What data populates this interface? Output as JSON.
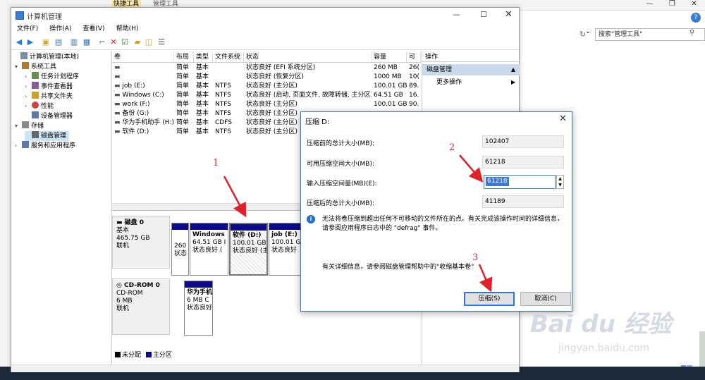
{
  "background": {
    "ribbon_tab_active": "快捷工具",
    "ribbon_tab_other": "管理工具",
    "search_placeholder": "搜索\"管理工具\""
  },
  "window": {
    "title": "计算机管理",
    "menu": [
      "文件(F)",
      "操作(A)",
      "查看(V)",
      "帮助(H)"
    ]
  },
  "tree": [
    {
      "label": "计算机管理(本地)",
      "indent": 0,
      "arrow": ""
    },
    {
      "label": "系统工具",
      "indent": 1,
      "arrow": "▾"
    },
    {
      "label": "任务计划程序",
      "indent": 2,
      "arrow": "›"
    },
    {
      "label": "事件查看器",
      "indent": 2,
      "arrow": "›"
    },
    {
      "label": "共享文件夹",
      "indent": 2,
      "arrow": "›"
    },
    {
      "label": "性能",
      "indent": 2,
      "arrow": "›"
    },
    {
      "label": "设备管理器",
      "indent": 2,
      "arrow": ""
    },
    {
      "label": "存储",
      "indent": 1,
      "arrow": "▾"
    },
    {
      "label": "磁盘管理",
      "indent": 2,
      "arrow": ""
    },
    {
      "label": "服务和应用程序",
      "indent": 1,
      "arrow": "›"
    }
  ],
  "volumes": {
    "columns": [
      "卷",
      "布局",
      "类型",
      "文件系统",
      "状态",
      "容量",
      "可"
    ],
    "rows": [
      [
        "",
        "简单",
        "基本",
        "",
        "状态良好 (EFI 系统分区)",
        "260 MB",
        "26("
      ],
      [
        "",
        "简单",
        "基本",
        "",
        "状态良好 (恢复分区)",
        "1000 MB",
        "10("
      ],
      [
        "job (E:)",
        "简单",
        "基本",
        "NTFS",
        "状态良好 (主分区)",
        "100.01 GB",
        "89."
      ],
      [
        "Windows (C:)",
        "简单",
        "基本",
        "NTFS",
        "状态良好 (启动, 页面文件, 故障转储, 主分区)",
        "64.51 GB",
        "16."
      ],
      [
        "work (F:)",
        "简单",
        "基本",
        "NTFS",
        "状态良好 (主分区)",
        "100.01 GB",
        "90."
      ],
      [
        "备份 (G:)",
        "简单",
        "基本",
        "NTFS",
        "状态良好 (主分区)",
        "",
        ""
      ],
      [
        "华为手机助手 (H:)",
        "简单",
        "基本",
        "CDFS",
        "状态良好 (主分区)",
        "",
        ""
      ],
      [
        "软件 (D:)",
        "简单",
        "基本",
        "NTFS",
        "状态良好 (主分区)",
        "",
        ""
      ]
    ]
  },
  "disks": {
    "disk0": {
      "name": "磁盘 0",
      "type": "基本",
      "size": "465.75 GB",
      "status": "联机"
    },
    "disk0_parts": [
      {
        "name": "",
        "size": "260",
        "status": "状态"
      },
      {
        "name": "Windows",
        "size": "64.51 GB I",
        "status": "状态良好 ("
      },
      {
        "name": "软件 (D:)",
        "size": "100.01 GB",
        "status": "状态良好 (主"
      },
      {
        "name": "job (E:)",
        "size": "100.01 G",
        "status": "状态良好"
      }
    ],
    "cdrom": {
      "name": "CD-ROM 0",
      "type": "CD-ROM",
      "size": "6 MB",
      "status": "联机"
    },
    "cdrom_part": {
      "name": "华为手机",
      "size": "6 MB C",
      "status": "状态良好"
    },
    "legend": [
      "未分配",
      "主分区"
    ]
  },
  "actions": {
    "header": "操作",
    "section": "磁盘管理",
    "more": "更多操作"
  },
  "dialog": {
    "title": "压缩 D:",
    "total_before_label": "压缩前的总计大小(MB):",
    "total_before_value": "102407",
    "available_label": "可用压缩空间大小(MB):",
    "available_value": "61218",
    "input_label": "输入压缩空间量(MB)(E):",
    "input_value": "61218",
    "total_after_label": "压缩后的总计大小(MB):",
    "total_after_value": "41189",
    "info": "无法将卷压缩到超出任何不可移动的文件所在的点。有关完成该操作时间的详细信息，请参阅应用程序日志中的 \"defrag\" 事件。",
    "more_info": "有关详细信息，请参阅磁盘管理帮助中的\"收缩基本卷\"",
    "shrink_button": "压缩(S)",
    "cancel_button": "取消(C)"
  },
  "annotations": [
    "1",
    "2",
    "3"
  ],
  "watermark": {
    "logo": "Bai du 经验",
    "url": "jingyan.baidu.com"
  },
  "colors": {
    "accent": "#3c7dd4",
    "primary_partition": "#0a0a8a",
    "annotation": "#e0202a"
  }
}
